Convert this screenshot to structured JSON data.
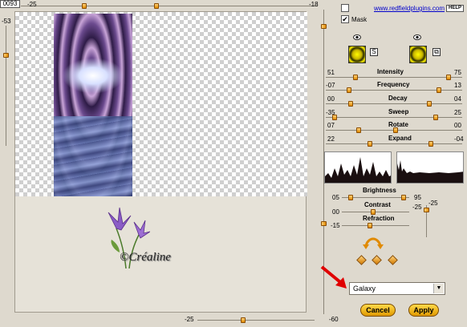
{
  "top_ruler": {
    "counter": "0093",
    "left_value": "-25",
    "right_value": "-18"
  },
  "left_ruler": {
    "value": "-53"
  },
  "bottom_ruler": {
    "value": "-25"
  },
  "right_ruler": {
    "value": "-60"
  },
  "header": {
    "link": "www.redfieldplugins.com",
    "help_label": "HELP",
    "mask_label": "Mask",
    "mask_checked": "✔"
  },
  "mode_icons": {
    "left_small": "S",
    "right_small": "⧉"
  },
  "sliders": [
    {
      "label": "Intensity",
      "left": "51",
      "right": "75"
    },
    {
      "label": "Frequency",
      "left": "-07",
      "right": "13"
    },
    {
      "label": "Decay",
      "left": "00",
      "right": "04"
    },
    {
      "label": "Sweep",
      "left": "-35",
      "right": "25"
    },
    {
      "label": "Rotate",
      "left": "07",
      "right": "00"
    },
    {
      "label": "Expand",
      "left": "22",
      "right": "-04"
    }
  ],
  "adjust": {
    "brightness": {
      "label": "Brightness",
      "left": "05",
      "right": "95"
    },
    "contrast": {
      "label": "Contrast",
      "left": "00",
      "right": "-25"
    },
    "refraction": {
      "label": "Refraction",
      "left": "-15"
    },
    "side_value": "-25"
  },
  "watermark": {
    "text": "©Créaline"
  },
  "preset": {
    "value": "Galaxy"
  },
  "buttons": {
    "cancel": "Cancel",
    "apply": "Apply"
  },
  "colors": {
    "accent": "#e08a00",
    "button": "#ffd94a",
    "arrow_red": "#e00000"
  }
}
